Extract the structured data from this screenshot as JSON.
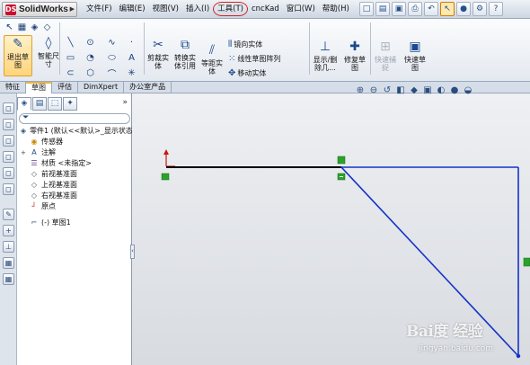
{
  "app": {
    "logo_text": "SolidWorks",
    "logo_mark": "DS"
  },
  "menu": {
    "items": [
      "文件(F)",
      "编辑(E)",
      "视图(V)",
      "插入(I)",
      "工具(T)",
      "cncKad",
      "窗口(W)",
      "帮助(H)"
    ],
    "highlighted": "工具(T)",
    "highlight_color": "#d42020"
  },
  "command_manager": {
    "exit_sketch": "退出草图",
    "smart_dimension_line1": "智能尺",
    "smart_dimension_line2": "寸",
    "trim_line1": "剪裁实",
    "trim_line2": "体",
    "convert_line1": "转换实",
    "convert_line2": "体引用",
    "offset_line1": "等距实",
    "offset_line2": "体",
    "mirror": "镜向实体",
    "linear_pattern": "线性草图阵列",
    "move": "移动实体",
    "display_relations_line1": "显示/删",
    "display_relations_line2": "除几...",
    "repair_line1": "修复草",
    "repair_line2": "图",
    "rapid_snap_line1": "快速捕",
    "rapid_snap_line2": "捉",
    "quick_sketch_line1": "快速草",
    "quick_sketch_line2": "图"
  },
  "tabs": {
    "items": [
      "特征",
      "草图",
      "评估",
      "DimXpert",
      "办公室产品"
    ],
    "active": "草图"
  },
  "feature_tree": {
    "part_line": "零件1 (默认<<默认>_显示状态",
    "nodes": [
      {
        "label": "传感器",
        "icon": "sensor-icon",
        "indent": 1,
        "expander": ""
      },
      {
        "label": "注解",
        "icon": "annotation-icon",
        "indent": 1,
        "expander": "+"
      },
      {
        "label": "材质 <未指定>",
        "icon": "material-icon",
        "indent": 1,
        "expander": ""
      },
      {
        "label": "前视基准面",
        "icon": "plane-icon",
        "indent": 1,
        "expander": ""
      },
      {
        "label": "上视基准面",
        "icon": "plane-icon",
        "indent": 1,
        "expander": ""
      },
      {
        "label": "右视基准面",
        "icon": "plane-icon",
        "indent": 1,
        "expander": ""
      },
      {
        "label": "原点",
        "icon": "origin-icon",
        "indent": 1,
        "expander": ""
      },
      {
        "label": "(-) 草图1",
        "icon": "sketch-icon",
        "indent": 1,
        "expander": ""
      }
    ]
  },
  "sketch": {
    "black_line_color": "#000000",
    "blue_line_color": "#1432c8",
    "origin_color": "#d01010",
    "relation_color": "#29a329"
  },
  "watermark": {
    "brand": "Bai度 经验",
    "url": "jingyan.baidu.com"
  }
}
